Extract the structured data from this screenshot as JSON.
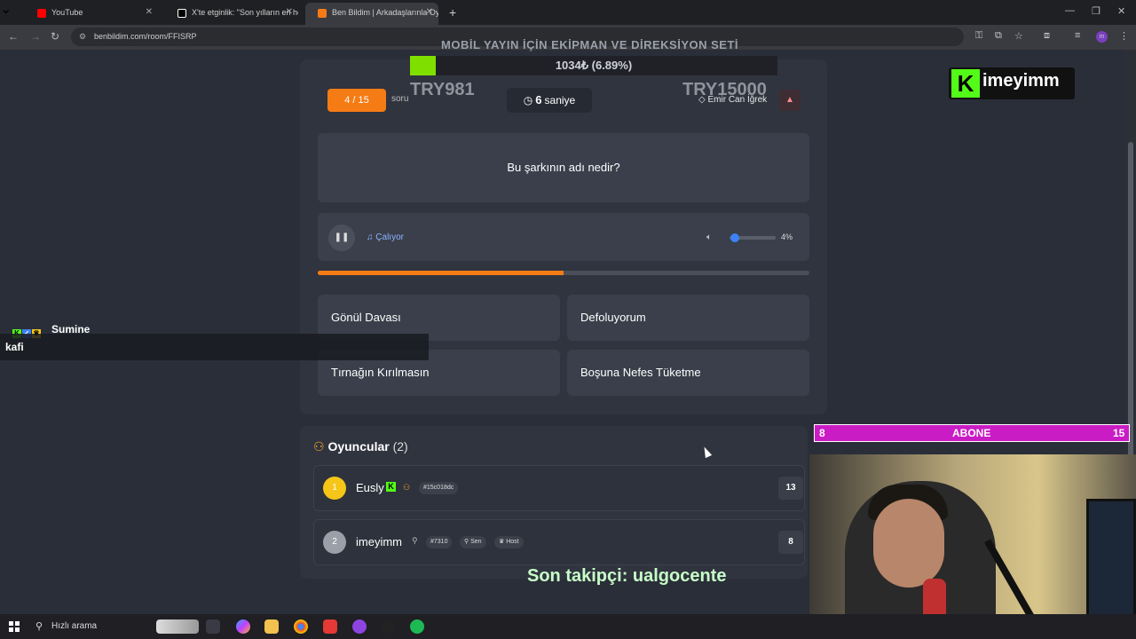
{
  "browser": {
    "tabs": [
      {
        "label": "YouTube",
        "color": "#ff0000"
      },
      {
        "label": "X'te etginlik: \"Son yılların en he",
        "color": "#ffffff"
      },
      {
        "label": "Ben Bildim | Arkadaşlarınla Oyna",
        "color": "#f57c14"
      }
    ],
    "url": "benbildim.com/room/FFISRP"
  },
  "quiz": {
    "question_counter": "4 / 15",
    "soru_label": "soru",
    "timer_value": "6",
    "timer_unit": "saniye",
    "author": "Emir Can İğrek",
    "question": "Bu şarkının adı nedir?",
    "playing_label": "Çalıyor",
    "volume": "4%",
    "volume_level": 0.04,
    "progress": 0.5,
    "answers": [
      "Gönül Davası",
      "Defoluyorum",
      "Tırnağın Kırılmasın",
      "Boşuna Nefes Tüketme"
    ]
  },
  "players": {
    "title": "Oyuncular",
    "count": "(2)",
    "rows": [
      {
        "rank": "1",
        "name": "Eusly",
        "id": "#15c018dc",
        "score": "13"
      },
      {
        "rank": "2",
        "name": "imeyimm",
        "id": "#7310",
        "you": "Sen",
        "host": "Host",
        "score": "8"
      }
    ]
  },
  "overlay": {
    "goal_title": "MOBİL YAYIN İÇİN EKİPMAN VE DİREKSİYON SETİ",
    "goal_text": "1034₺ (6.89%)",
    "goal_progress": 0.0689,
    "goal_min": "TRY981",
    "goal_max": "TRY15000",
    "kick_logo": "K",
    "kick_name": "imeyimm",
    "chat_user": "Sumine",
    "chat_message": "kafi",
    "sub_left": "8",
    "sub_label": "ABONE",
    "sub_right": "15",
    "last_follower": "Son takipçi: ualgocente"
  },
  "taskbar": {
    "search_placeholder": "Hızlı arama"
  }
}
